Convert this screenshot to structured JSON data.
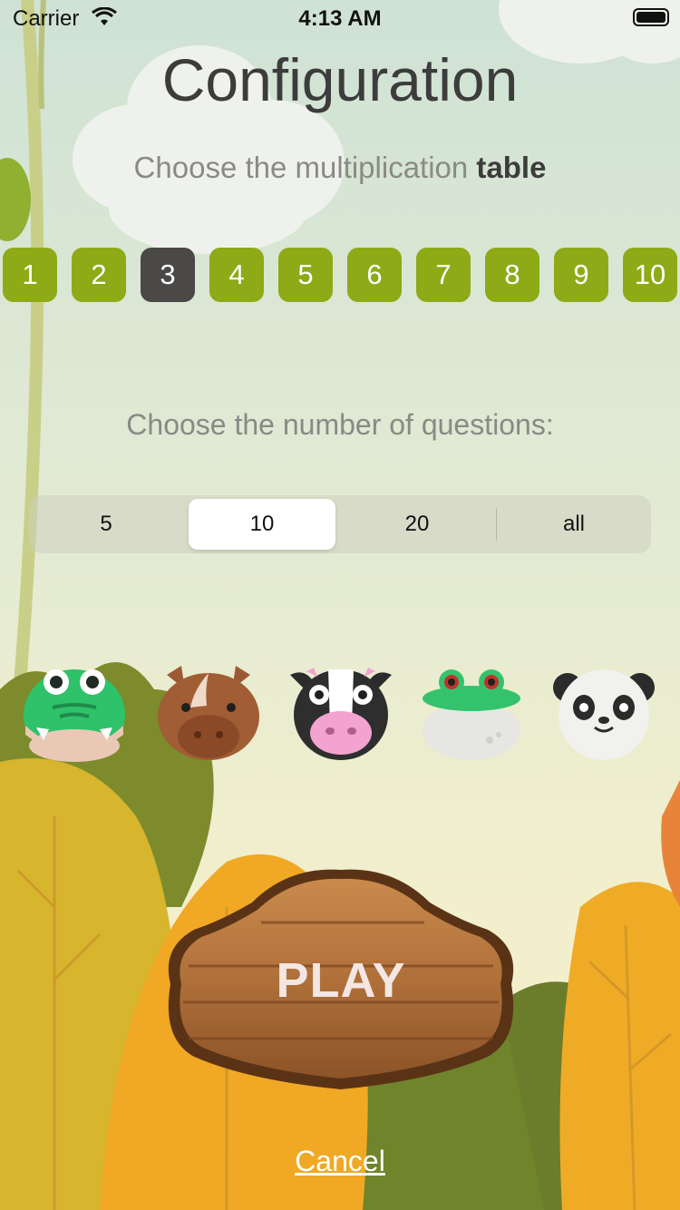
{
  "status_bar": {
    "carrier": "Carrier",
    "time": "4:13 AM"
  },
  "header": {
    "title": "Configuration",
    "subtitle_prefix": "Choose the multiplication ",
    "subtitle_bold": "table"
  },
  "tables": {
    "items": [
      "1",
      "2",
      "3",
      "4",
      "5",
      "6",
      "7",
      "8",
      "9",
      "10"
    ],
    "selected": "3",
    "accent": "#8eaa17",
    "selected_color": "#4b4848"
  },
  "questions": {
    "label": "Choose the number of questions:",
    "options": [
      "5",
      "10",
      "20",
      "all"
    ],
    "selected": "10"
  },
  "animals": [
    "crocodile-icon",
    "horse-icon",
    "cow-icon",
    "frog-icon",
    "panda-icon"
  ],
  "actions": {
    "play_label": "PLAY",
    "cancel_label": "Cancel"
  }
}
